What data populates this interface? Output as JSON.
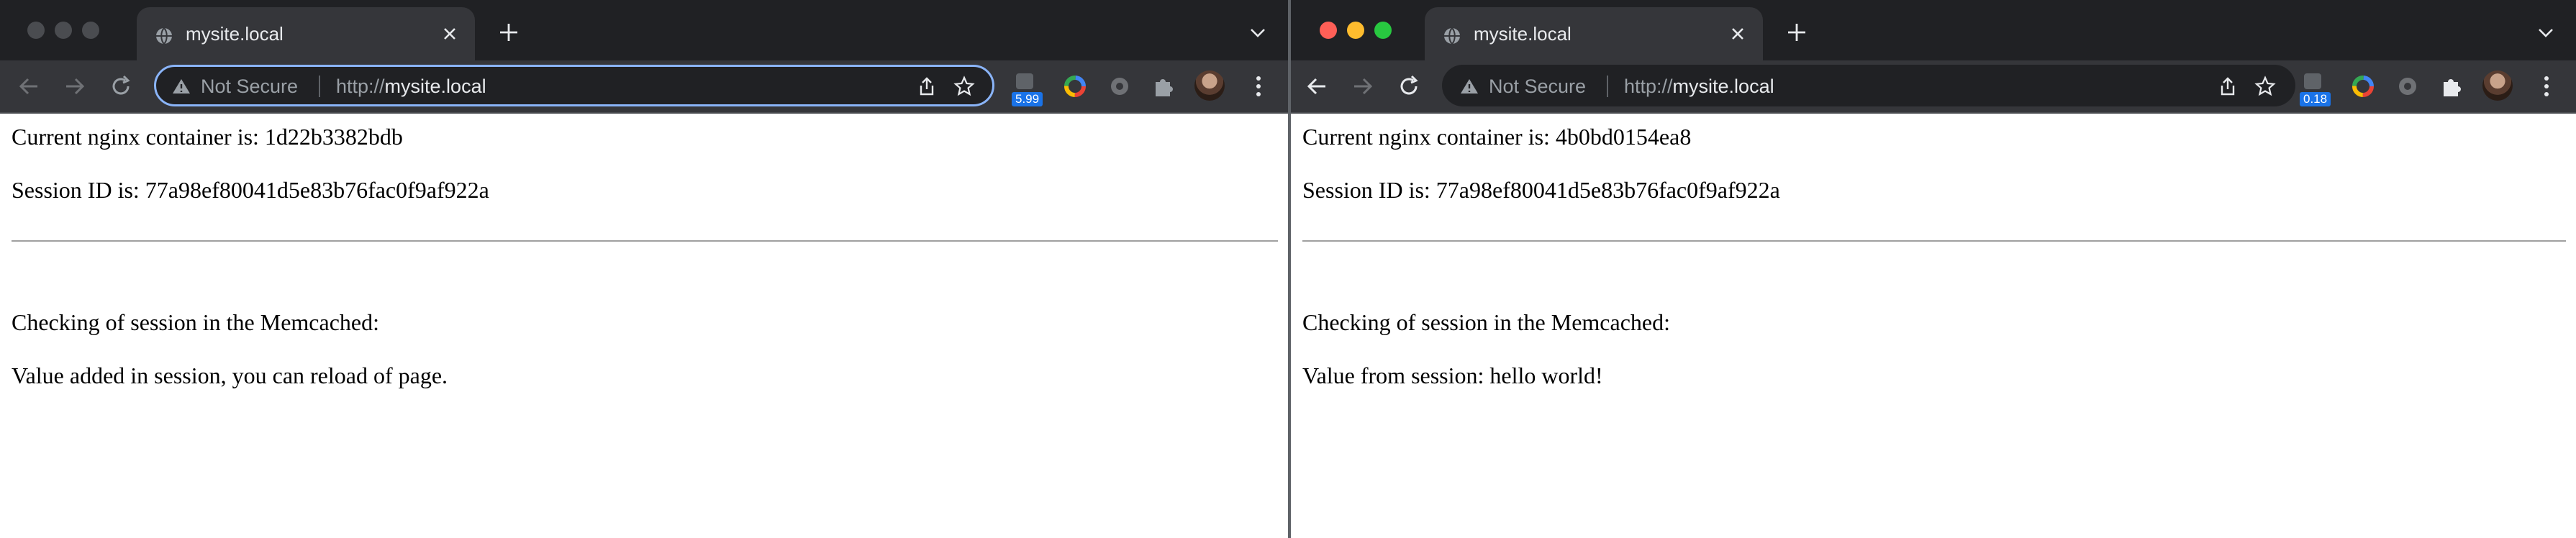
{
  "windows": [
    {
      "id": "left",
      "state": "inactive",
      "tab_title": "mysite.local",
      "security_label": "Not Secure",
      "url_prefix": "http://",
      "url_host": "mysite.local",
      "extension_badge": "5.99",
      "content": {
        "container_line": "Current nginx container is: 1d22b3382bdb",
        "session_line": "Session ID is: 77a98ef80041d5e83b76fac0f9af922a",
        "memcached_heading": "Checking of session in the Memcached:",
        "result_line": "Value added in session, you can reload of page."
      }
    },
    {
      "id": "right",
      "state": "active",
      "tab_title": "mysite.local",
      "security_label": "Not Secure",
      "url_prefix": "http://",
      "url_host": "mysite.local",
      "extension_badge": "0.18",
      "content": {
        "container_line": "Current nginx container is: 4b0bd0154ea8",
        "session_line": "Session ID is: 77a98ef80041d5e83b76fac0f9af922a",
        "memcached_heading": "Checking of session in the Memcached:",
        "result_line": "Value from session: hello world!"
      }
    }
  ],
  "icons": [
    "globe-icon",
    "close-icon",
    "new-tab-icon",
    "tab-search-icon",
    "back-icon",
    "forward-icon",
    "reload-icon",
    "warning-icon",
    "share-icon",
    "bookmark-star-icon",
    "extension-icon",
    "color-wheel-icon",
    "gear-icon",
    "puzzle-icon",
    "avatar",
    "kebab-menu-icon"
  ],
  "colors": {
    "chrome_dark": "#202124",
    "toolbar": "#35363a",
    "focus_ring": "#8ab4f8",
    "badge": "#1a73e8"
  }
}
